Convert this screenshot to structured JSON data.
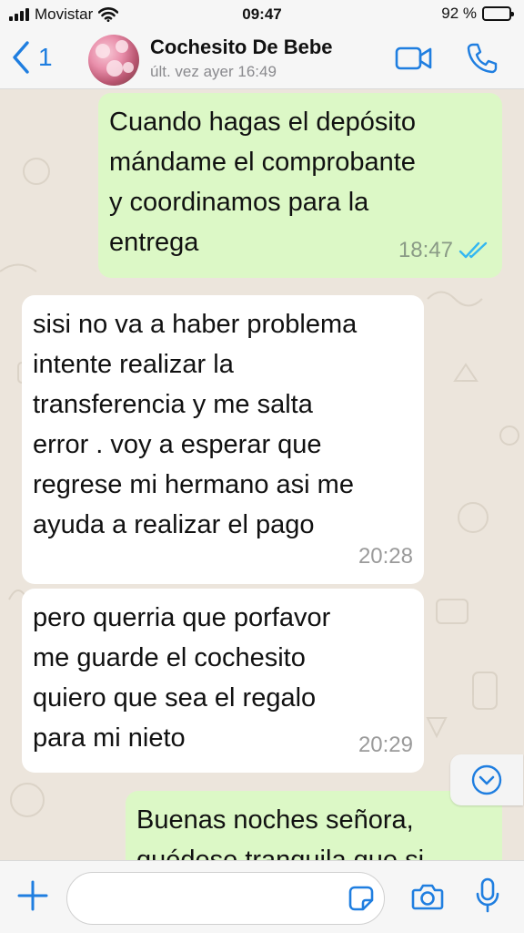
{
  "status_bar": {
    "carrier": "Movistar",
    "time": "09:47",
    "battery_percent": "92 %",
    "battery_level": 0.92
  },
  "header": {
    "back_count": "1",
    "contact_name": "Cochesito De Bebe",
    "last_seen": "últ. vez ayer 16:49"
  },
  "messages": [
    {
      "direction": "outgoing",
      "text": "Cuando hagas el depósito\nmándame el comprobante\ny coordinamos para la\nentrega",
      "time": "18:47",
      "status": "read"
    },
    {
      "direction": "incoming",
      "text": "sisi no va a haber problema\nintente realizar la\ntransferencia y me salta\nerror . voy a esperar que\nregrese mi hermano asi me\nayuda a realizar el pago",
      "time": "20:28"
    },
    {
      "direction": "incoming",
      "text": "pero querria que porfavor\nme guarde el cochesito\nquiero que sea el regalo\npara mi nieto",
      "time": "20:29"
    },
    {
      "direction": "outgoing",
      "text": "Buenas noches señora,\nquédese tranquila que si"
    }
  ],
  "colors": {
    "accent": "#1f7ee0",
    "outgoing_bubble": "#dcf8c6",
    "incoming_bubble": "#ffffff",
    "wallpaper": "#ece5dc",
    "read_ticks": "#34b7f1"
  },
  "icons": {
    "back": "chevron-left-icon",
    "video": "video-camera-icon",
    "call": "phone-icon",
    "scroll": "chevron-down-circle-icon",
    "attach": "plus-icon",
    "sticker": "sticker-icon",
    "camera": "camera-icon",
    "mic": "microphone-icon"
  },
  "composer": {
    "value": ""
  }
}
